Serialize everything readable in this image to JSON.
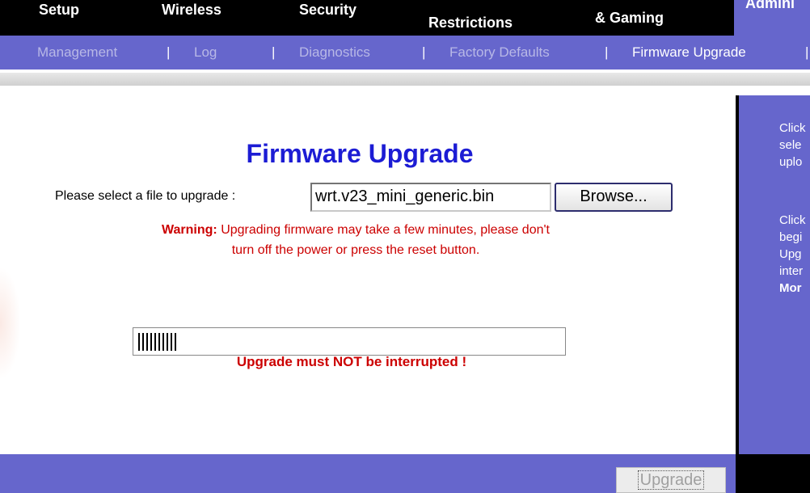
{
  "top_tabs": [
    "Setup",
    "Wireless",
    "Security",
    "Restrictions",
    "& Gaming",
    "Admini"
  ],
  "subnav": [
    "Management",
    "|",
    "Log",
    "|",
    "Diagnostics",
    "|",
    "Factory Defaults",
    "|",
    "Firmware Upgrade",
    "|"
  ],
  "main": {
    "title": "Firmware Upgrade",
    "file_label": "Please select a file to upgrade :",
    "file_value": "wrt.v23_mini_generic.bin",
    "browse_label": "Browse...",
    "warning_prefix": "Warning:",
    "warning_line1": "Upgrading firmware may take a few minutes, please don't",
    "warning_line2": "turn off the power or press the reset button.",
    "progress_fraction": 0.09,
    "progress_text": "||||||||",
    "not_interrupt": "Upgrade must NOT be interrupted !",
    "upgrade_label": "Upgrade"
  },
  "side_panel": {
    "lines": [
      "Click",
      "sele",
      "uplo",
      "",
      "Click",
      "begi",
      "Upg",
      "inter",
      "Mor"
    ]
  },
  "colors": {
    "nav_purple": "#6666cc",
    "title_blue": "#1c1cd4",
    "warning_red": "#cc0000"
  }
}
